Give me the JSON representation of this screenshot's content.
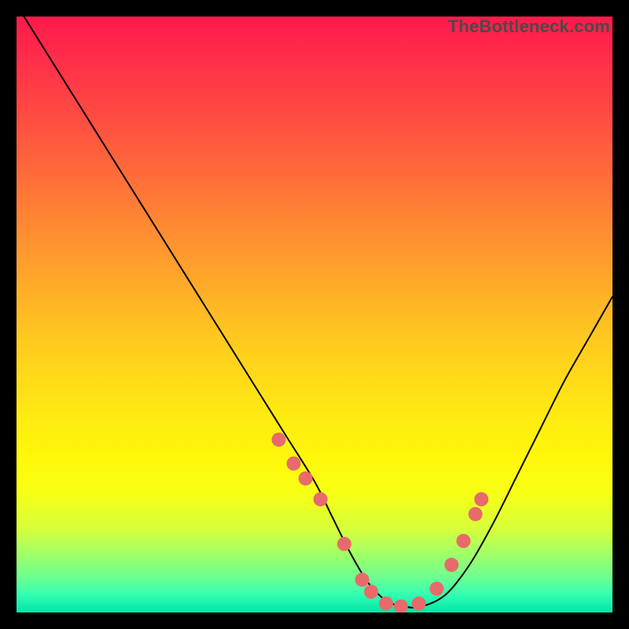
{
  "watermark": "TheBottleneck.com",
  "chart_data": {
    "type": "line",
    "title": "",
    "xlabel": "",
    "ylabel": "",
    "xlim": [
      0,
      100
    ],
    "ylim": [
      0,
      100
    ],
    "grid": false,
    "legend": false,
    "series": [
      {
        "name": "bottleneck-curve",
        "x": [
          0,
          5,
          10,
          15,
          20,
          25,
          30,
          35,
          40,
          45,
          50,
          53,
          56,
          59,
          62,
          65,
          68,
          72,
          76,
          80,
          84,
          88,
          92,
          96,
          100
        ],
        "y": [
          102,
          94,
          86,
          78,
          70,
          62,
          54,
          46,
          38,
          30,
          22,
          16,
          10,
          5,
          2,
          1,
          1,
          3,
          8,
          15,
          23,
          31,
          39,
          46,
          53
        ]
      }
    ],
    "markers": {
      "name": "valley-dots",
      "x": [
        44.0,
        46.5,
        48.5,
        51.0,
        55.0,
        58.0,
        59.5,
        62.0,
        64.5,
        67.5,
        70.5,
        73.0,
        75.0,
        77.0,
        78.0
      ],
      "y": [
        29.0,
        25.0,
        22.5,
        19.0,
        11.5,
        5.5,
        3.5,
        1.5,
        1.0,
        1.5,
        4.0,
        8.0,
        12.0,
        16.5,
        19.0
      ]
    },
    "marker_radius_px": 9,
    "gradient_stops": [
      {
        "pos": 0.0,
        "color": "#ff1a4b"
      },
      {
        "pos": 0.4,
        "color": "#ff9a2e"
      },
      {
        "pos": 0.7,
        "color": "#fff80a"
      },
      {
        "pos": 0.9,
        "color": "#a3ff66"
      },
      {
        "pos": 1.0,
        "color": "#00e6a8"
      }
    ]
  }
}
